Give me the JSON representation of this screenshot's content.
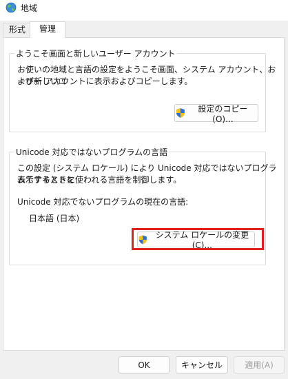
{
  "window": {
    "title": "地域",
    "icon": "globe-icon"
  },
  "tabs": [
    {
      "label": "形式",
      "active": false
    },
    {
      "label": "管理",
      "active": true
    }
  ],
  "welcome_group": {
    "legend": "ようこそ画面と新しいユーザー アカウント",
    "line1": "お使いの地域と言語の設定をようこそ画面、システム アカウント、および新しいユ",
    "line2": "ーザー アカウントに表示およびコピーします。",
    "copy_button": "設定のコピー(O)...",
    "copy_button_icon": "uac-shield-icon"
  },
  "unicode_group": {
    "legend": "Unicode 対応ではないプログラムの言語",
    "line1": "この設定 (システム ロケール) により Unicode 対応ではないプログラムでテキストを",
    "line2": "表示するときに使われる言語を制御します。",
    "current_label": "Unicode 対応でないプログラムの現在の言語:",
    "current_value": "日本語 (日本)",
    "change_button": "システム ロケールの変更(C)...",
    "change_button_icon": "uac-shield-icon",
    "highlight_color": "#e0201f"
  },
  "footer": {
    "ok": "OK",
    "cancel": "キャンセル",
    "apply": "適用(A)"
  }
}
